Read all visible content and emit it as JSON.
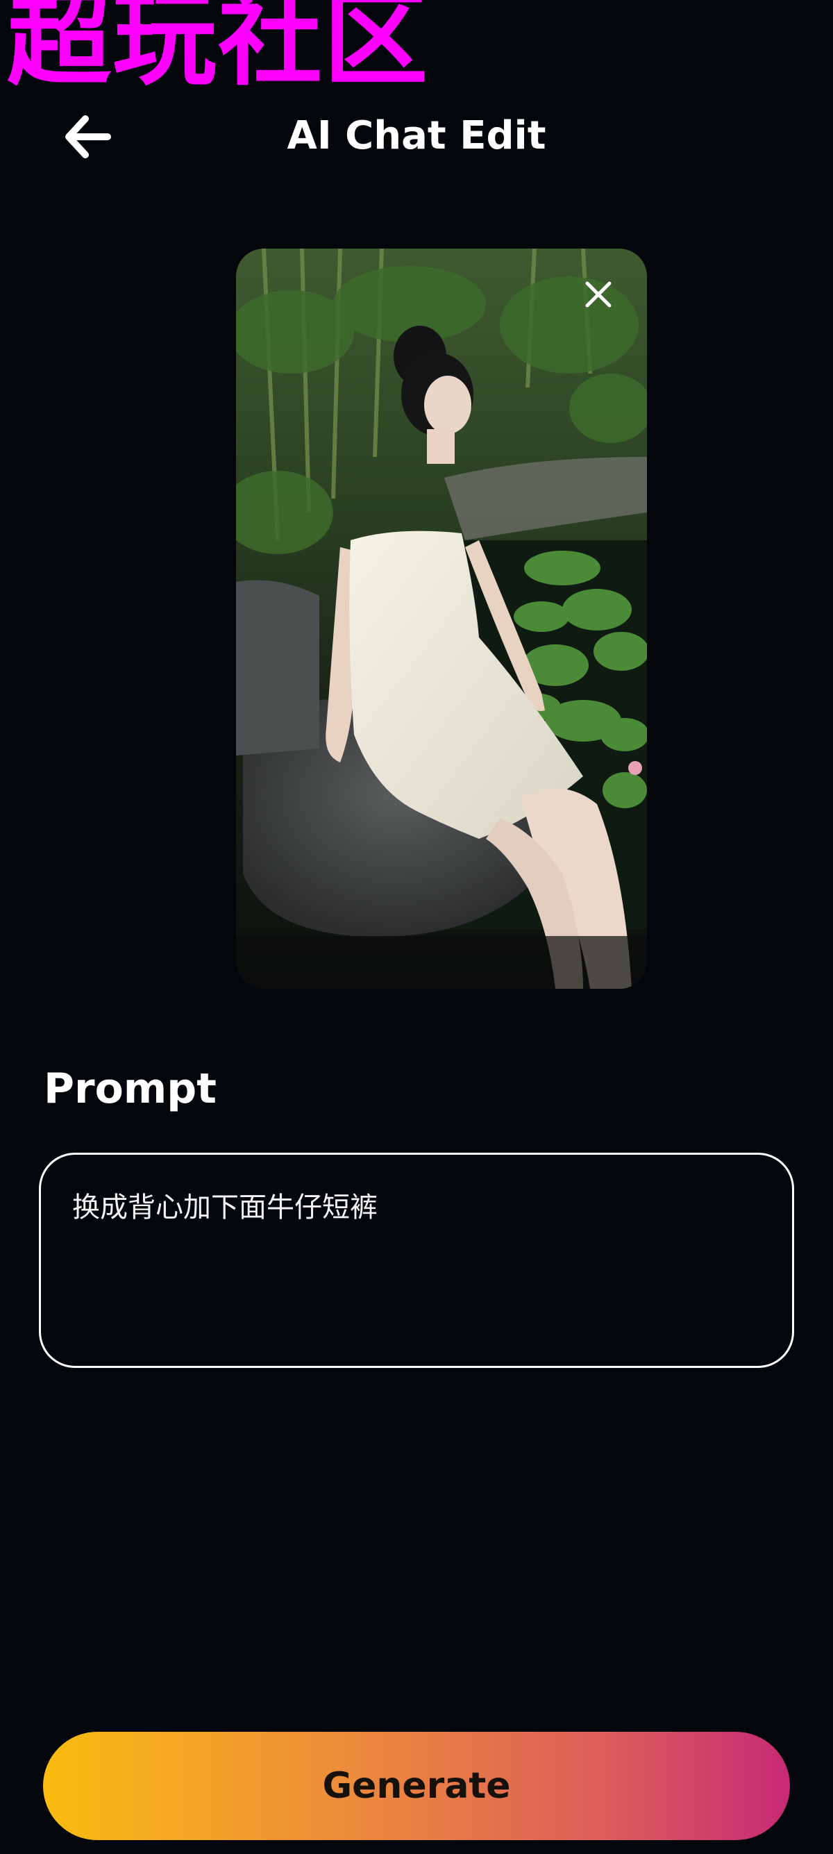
{
  "watermark": {
    "text": "超玩社区",
    "color": "#ff00ff"
  },
  "header": {
    "back_icon": "arrow-left-icon",
    "title": "AI Chat Edit"
  },
  "image_card": {
    "remove_icon": "close-icon"
  },
  "prompt": {
    "label": "Prompt",
    "value": "换成背心加下面牛仔短裤"
  },
  "generate": {
    "label": "Generate",
    "gradient": [
      "#f9bc10",
      "#ee8c3a",
      "#dd5e5a",
      "#c72a76"
    ]
  },
  "colors": {
    "background": "#03060a",
    "text": "#ffffff",
    "prompt_border": "#ffffff"
  }
}
